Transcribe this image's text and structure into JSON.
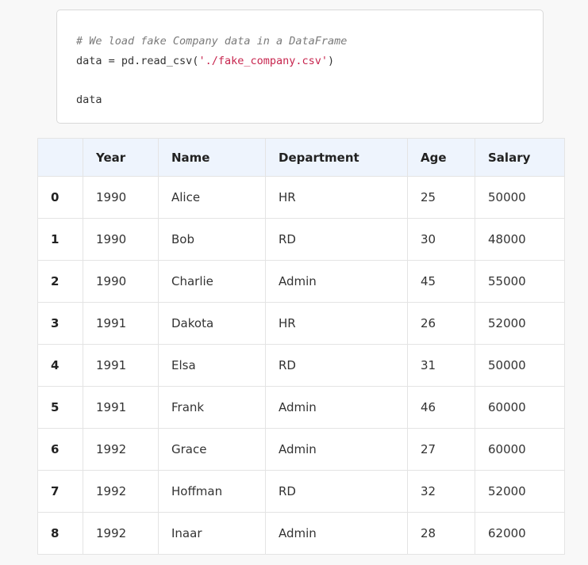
{
  "code_cell": {
    "comment": "# We load fake Company data in a DataFrame",
    "line2_prefix": "data = pd.read_csv(",
    "line2_string": "'./fake_company.csv'",
    "line2_suffix": ")",
    "line4": "data"
  },
  "table": {
    "index_header": "",
    "columns": [
      "Year",
      "Name",
      "Department",
      "Age",
      "Salary"
    ],
    "rows": [
      {
        "index": "0",
        "cells": [
          "1990",
          "Alice",
          "HR",
          "25",
          "50000"
        ]
      },
      {
        "index": "1",
        "cells": [
          "1990",
          "Bob",
          "RD",
          "30",
          "48000"
        ]
      },
      {
        "index": "2",
        "cells": [
          "1990",
          "Charlie",
          "Admin",
          "45",
          "55000"
        ]
      },
      {
        "index": "3",
        "cells": [
          "1991",
          "Dakota",
          "HR",
          "26",
          "52000"
        ]
      },
      {
        "index": "4",
        "cells": [
          "1991",
          "Elsa",
          "RD",
          "31",
          "50000"
        ]
      },
      {
        "index": "5",
        "cells": [
          "1991",
          "Frank",
          "Admin",
          "46",
          "60000"
        ]
      },
      {
        "index": "6",
        "cells": [
          "1992",
          "Grace",
          "Admin",
          "27",
          "60000"
        ]
      },
      {
        "index": "7",
        "cells": [
          "1992",
          "Hoffman",
          "RD",
          "32",
          "52000"
        ]
      },
      {
        "index": "8",
        "cells": [
          "1992",
          "Inaar",
          "Admin",
          "28",
          "62000"
        ]
      }
    ]
  },
  "colors": {
    "page_background": "#f8f8f8",
    "header_background": "#eef4fd",
    "string_literal": "#c7254e",
    "comment": "#7a7a7a"
  }
}
